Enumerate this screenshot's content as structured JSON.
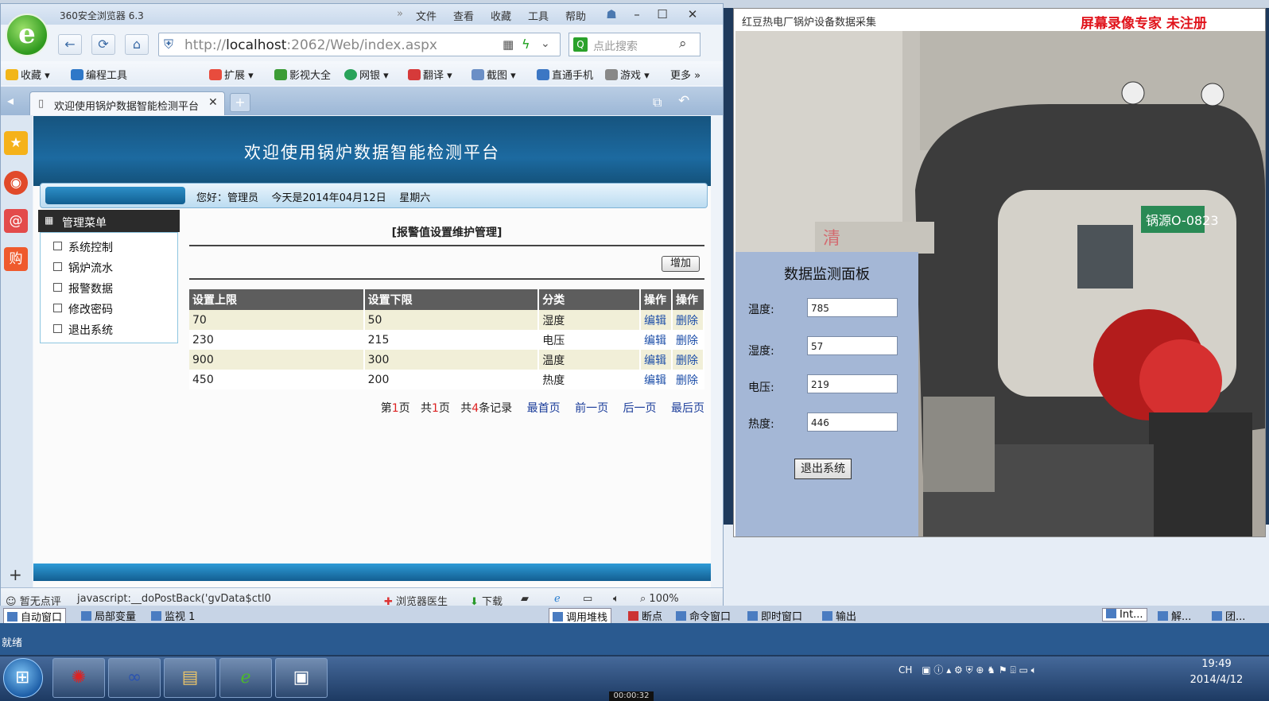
{
  "browser": {
    "title": "360安全浏览器 6.3",
    "menu": [
      "文件",
      "查看",
      "收藏",
      "工具",
      "帮助"
    ],
    "url_host": "localhost",
    "url_prefix": "http://",
    "url_rest": ":2062/Web/index.aspx",
    "search_placeholder": "点此搜索",
    "bookmarks": [
      "收藏",
      "编程工具",
      "扩展",
      "影视大全",
      "网银",
      "翻译",
      "截图",
      "直通手机",
      "游戏",
      "更多"
    ],
    "tab_title": "欢迎使用锅炉数据智能检测平台",
    "status_items": [
      "暂无点评",
      "javascript:__doPostBack('gvData$ctl0",
      "浏览器医生",
      "下载",
      "100%"
    ]
  },
  "page": {
    "banner_title": "欢迎使用锅炉数据智能检测平台",
    "greeting": "您好：管理员    今天是2014年04月12日    星期六",
    "menu_title": "管理菜单",
    "menu_items": [
      "系统控制",
      "锅炉流水",
      "报警数据",
      "修改密码",
      "退出系统"
    ],
    "section_title": "[报警值设置维护管理]",
    "add_label": "增加",
    "table": {
      "headers": [
        "设置上限",
        "设置下限",
        "分类",
        "操作",
        "操作"
      ],
      "rows": [
        {
          "upper": "70",
          "lower": "50",
          "type": "湿度",
          "edit": "编辑",
          "del": "删除"
        },
        {
          "upper": "230",
          "lower": "215",
          "type": "电压",
          "edit": "编辑",
          "del": "删除"
        },
        {
          "upper": "900",
          "lower": "300",
          "type": "温度",
          "edit": "编辑",
          "del": "删除"
        },
        {
          "upper": "450",
          "lower": "200",
          "type": "热度",
          "edit": "编辑",
          "del": "删除"
        }
      ]
    },
    "pager": {
      "page_prefix": "第",
      "page_num": "1",
      "page_suffix": "页",
      "total_prefix": "共",
      "total_num": "1",
      "total_suffix": "页",
      "rec_prefix": "共",
      "rec_num": "4",
      "rec_suffix": "条记录",
      "first": "最首页",
      "prev": "前一页",
      "next": "后一页",
      "last": "最后页"
    }
  },
  "monitor": {
    "title": "红豆热电厂锅炉设备数据采集",
    "watermark": "屏幕录像专家  未注册",
    "panel_title": "数据监测面板",
    "fields": [
      {
        "label": "温度:",
        "value": "785"
      },
      {
        "label": "湿度:",
        "value": "57"
      },
      {
        "label": "电压:",
        "value": "219"
      },
      {
        "label": "热度:",
        "value": "446"
      }
    ],
    "exit_label": "退出系统",
    "boiler_plate": "锅源O-0823"
  },
  "vs": {
    "pane_tabs": [
      "自动窗口",
      "局部变量",
      "监视 1",
      "调用堆栈",
      "断点",
      "命令窗口",
      "即时窗口",
      "输出",
      "Int...",
      "解...",
      "团..."
    ],
    "status": "就绪"
  },
  "taskbar": {
    "lang": "CH",
    "time": "19:49",
    "date": "2014/4/12",
    "rec_time": "00:00:32"
  }
}
